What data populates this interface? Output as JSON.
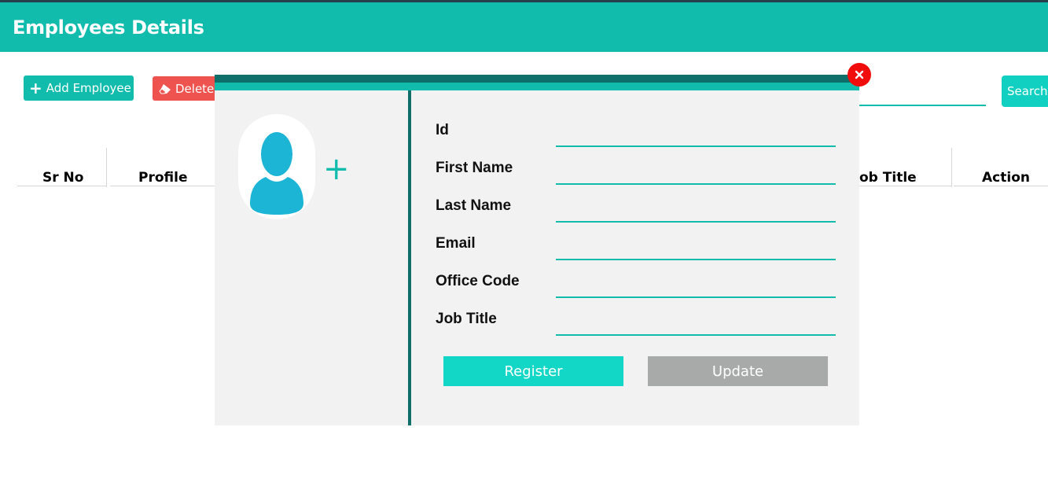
{
  "header": {
    "title": "Employees Details"
  },
  "toolbar": {
    "add_label": "Add Employee",
    "delete_label": "Delete",
    "search_label": "Search",
    "search_value": ""
  },
  "table": {
    "columns": [
      "Sr No",
      "Profile",
      "ob Title",
      "Action"
    ]
  },
  "modal": {
    "fields": [
      {
        "label": "Id",
        "value": ""
      },
      {
        "label": "First Name",
        "value": ""
      },
      {
        "label": "Last Name",
        "value": ""
      },
      {
        "label": "Email",
        "value": ""
      },
      {
        "label": "Office Code",
        "value": ""
      },
      {
        "label": "Job Title",
        "value": ""
      }
    ],
    "register_label": "Register",
    "update_label": "Update",
    "avatar_add_label": "+"
  },
  "colors": {
    "accent": "#12bcad",
    "accent_dark": "#0e6e69",
    "delete": "#ef5350",
    "close": "#f20d0d",
    "update_disabled": "#a8aaa9"
  }
}
